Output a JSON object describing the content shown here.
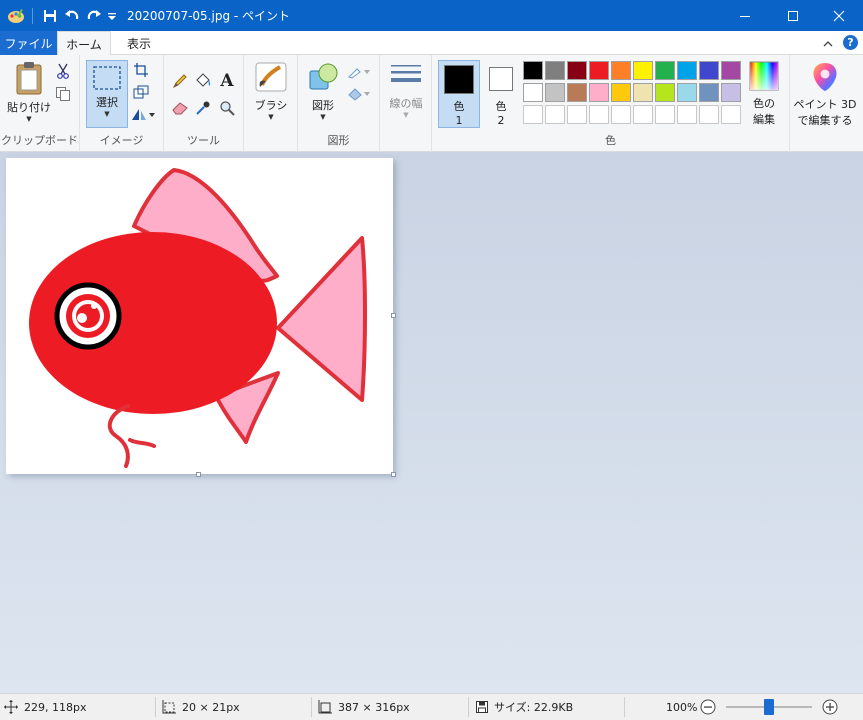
{
  "window": {
    "title": "20200707-05.jpg - ペイント"
  },
  "tabs": {
    "file": "ファイル",
    "home": "ホーム",
    "view": "表示"
  },
  "ribbon": {
    "clipboard": {
      "paste": "貼り付け",
      "label": "クリップボード"
    },
    "image": {
      "select": "選択",
      "label": "イメージ"
    },
    "tools": {
      "label": "ツール"
    },
    "brushes": {
      "label": "ブラシ"
    },
    "shapes": {
      "shapes": "図形",
      "label": "図形"
    },
    "size": {
      "label": "線の幅"
    },
    "color1": {
      "line1": "色",
      "line2": "1"
    },
    "color2": {
      "line1": "色",
      "line2": "2"
    },
    "colors": {
      "label": "色",
      "edit_line1": "色の",
      "edit_line2": "編集",
      "palette_row1": [
        "#000000",
        "#7f7f7f",
        "#880015",
        "#ed1c24",
        "#ff7f27",
        "#fff200",
        "#22b14c",
        "#00a2e8",
        "#3f48cc",
        "#a349a4"
      ],
      "palette_row2": [
        "#ffffff",
        "#c3c3c3",
        "#b97a57",
        "#ffaec9",
        "#ffc90e",
        "#efe4b0",
        "#b5e61d",
        "#99d9ea",
        "#7092be",
        "#c8bfe7"
      ]
    },
    "paint3d": {
      "line1": "ペイント 3D",
      "line2": "で編集する"
    }
  },
  "status": {
    "cursor": "229, 118px",
    "selection": "20 × 21px",
    "image_size": "387 × 316px",
    "file_size": "サイズ: 22.9KB",
    "zoom": "100%",
    "zoom_level_fraction": 0.5
  },
  "colors": {
    "titlebar": "#0a64c8",
    "accent": "#1a6cd1",
    "fish_body": "#ed1c24",
    "fish_fin": "#ffaec9",
    "fish_outline": "#e0313a"
  }
}
